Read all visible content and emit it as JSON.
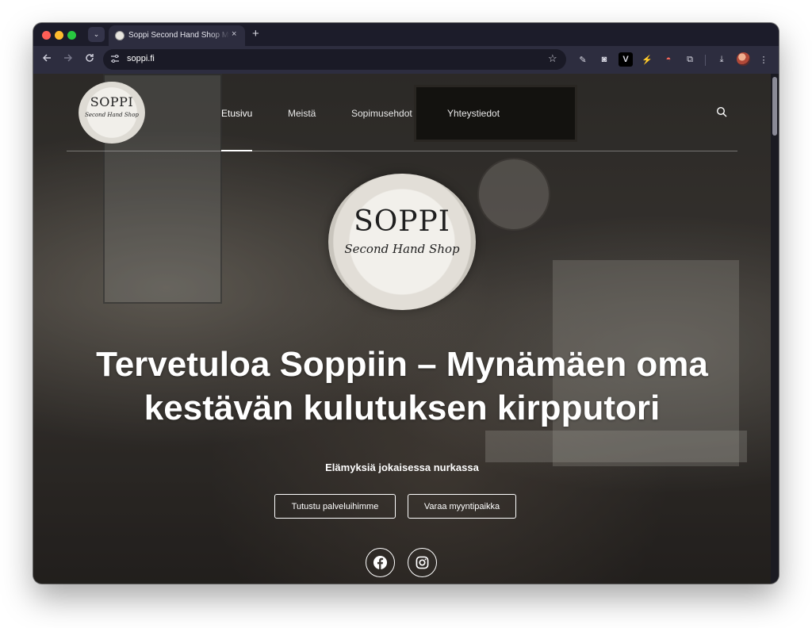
{
  "browser": {
    "tab_title": "Soppi Second Hand Shop Mynämäki",
    "tab_close": "×",
    "new_tab": "+",
    "tab_menu": "⌄",
    "url": "soppi.fi",
    "star": "☆",
    "ext_pinned": [
      {
        "name": "eyedropper-extension-icon",
        "glyph": "✎"
      },
      {
        "name": "camera-extension-icon",
        "glyph": "◙"
      },
      {
        "name": "v-extension-icon",
        "glyph": "V"
      },
      {
        "name": "bolt-extension-icon",
        "glyph": "⚡"
      },
      {
        "name": "pokeball-extension-icon",
        "glyph": "◓"
      },
      {
        "name": "puzzle-extensions-icon",
        "glyph": "⧉"
      }
    ],
    "download_glyph": "⤓",
    "menu_glyph": "⋮"
  },
  "site": {
    "logo_name": "SOPPI",
    "logo_tag": "Second Hand Shop",
    "nav": [
      {
        "label": "Etusivu",
        "active": true
      },
      {
        "label": "Meistä",
        "active": false
      },
      {
        "label": "Sopimusehdot",
        "active": false
      },
      {
        "label": "Yhteystiedot",
        "active": false
      }
    ]
  },
  "hero": {
    "title": "Tervetuloa Soppiin – Mynämäen oma kestävän kulutuksen kirpputori",
    "subtitle": "Elämyksiä jokaisessa nurkassa",
    "buttons": [
      "Tutustu palveluihimme",
      "Varaa myyntipaikka"
    ],
    "social": [
      "facebook-icon",
      "instagram-icon"
    ]
  },
  "colors": {
    "chrome_dark": "#1c1c2a",
    "chrome_toolbar": "#2d2d3f",
    "hero_text": "#ffffff"
  }
}
